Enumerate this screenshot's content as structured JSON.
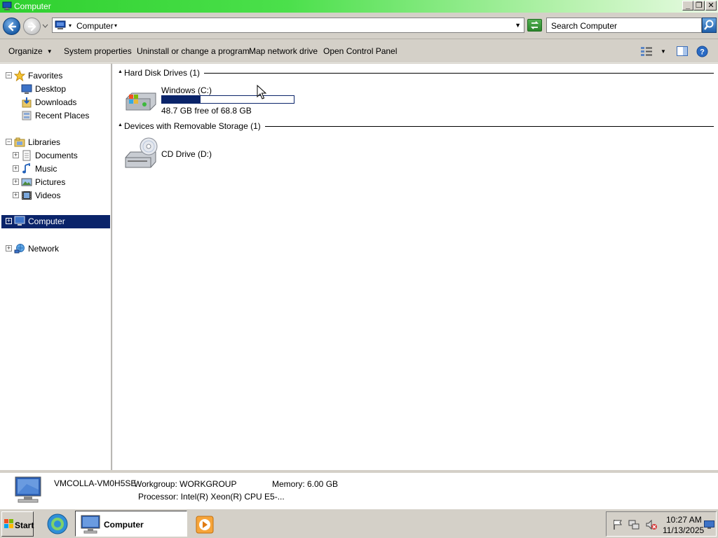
{
  "window": {
    "title": "Computer",
    "minimize": "_",
    "restore": "❐",
    "close": "✕"
  },
  "address": {
    "location": "Computer",
    "search_placeholder": "Search Computer"
  },
  "commands": {
    "organize": "Organize",
    "system_properties": "System properties",
    "uninstall": "Uninstall or change a program",
    "map_drive": "Map network drive",
    "control_panel": "Open Control Panel"
  },
  "nav": {
    "favorites": "Favorites",
    "desktop": "Desktop",
    "downloads": "Downloads",
    "recent_places": "Recent Places",
    "libraries": "Libraries",
    "documents": "Documents",
    "music": "Music",
    "pictures": "Pictures",
    "videos": "Videos",
    "computer": "Computer",
    "network": "Network"
  },
  "groups": {
    "hdd": "Hard Disk Drives (1)",
    "removable": "Devices with Removable Storage (1)"
  },
  "drives": {
    "c": {
      "name": "Windows (C:)",
      "free_text": "48.7 GB free of 68.8 GB",
      "used_fraction": 0.29
    },
    "d": {
      "name": "CD Drive (D:)"
    }
  },
  "details": {
    "computer_name": "VMCOLLA-VM0H5SE",
    "workgroup": "Workgroup: WORKGROUP",
    "memory": "Memory: 6.00 GB",
    "processor": "Processor: Intel(R) Xeon(R) CPU E5-..."
  },
  "taskbar": {
    "start": "Start",
    "task": "Computer",
    "time": "10:27 AM",
    "date": "11/13/2025"
  },
  "colors": {
    "selection": "#0a246a",
    "titlebar": "#2fd02f"
  }
}
